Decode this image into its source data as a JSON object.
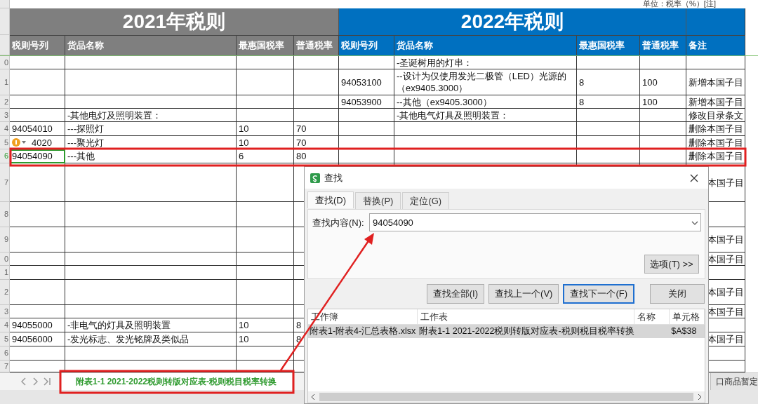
{
  "unit_note": "单位：税率（%）[注]",
  "sections": [
    {
      "title": "2021年税则",
      "kind": "grey"
    },
    {
      "title": "2022年税则",
      "kind": "blue"
    }
  ],
  "columns": [
    {
      "label": "税则号列",
      "kind": "grey"
    },
    {
      "label": "货品名称",
      "kind": "grey"
    },
    {
      "label": "最惠国税率",
      "kind": "grey"
    },
    {
      "label": "普通税率",
      "kind": "grey"
    },
    {
      "label": "税则号列",
      "kind": "blue"
    },
    {
      "label": "货品名称",
      "kind": "blue"
    },
    {
      "label": "最惠国税率",
      "kind": "blue"
    },
    {
      "label": "普通税率",
      "kind": "blue"
    },
    {
      "label": "备注",
      "kind": "blue"
    }
  ],
  "rows": [
    {
      "row_number": "0",
      "selected": false,
      "name_2022": "-圣诞树用的灯串："
    },
    {
      "row_number": "1",
      "selected": false,
      "code_2022": "94053100",
      "name_2022": "--设计为仅使用发光二极管（LED）光源的（ex9405.3000）",
      "mfn_2022": "8",
      "general_2022": "100",
      "note": "新增本国子目"
    },
    {
      "row_number": "2",
      "selected": false,
      "code_2022": "94053900",
      "name_2022": "--其他（ex9405.3000）",
      "mfn_2022": "8",
      "general_2022": "100",
      "note": "新增本国子目"
    },
    {
      "row_number": "3",
      "selected": false,
      "name_2021": "-其他电灯及照明装置：",
      "name_2022": "-其他电气灯具及照明装置：",
      "note": "修改目录条文"
    },
    {
      "row_number": "4",
      "selected": false,
      "code_2021": "94054010",
      "name_2021": "---探照灯",
      "mfn_2021": "10",
      "general_2021": "70",
      "note": "删除本国子目"
    },
    {
      "row_number": "5",
      "selected": false,
      "warning": true,
      "code_2021": "4020",
      "name_2021": "---聚光灯",
      "mfn_2021": "10",
      "general_2021": "70",
      "note": "删除本国子目"
    },
    {
      "row_number": "6",
      "selected": true,
      "code_2021": "94054090",
      "name_2021": "---其他",
      "mfn_2021": "6",
      "general_2021": "80",
      "note": "删除本国子目"
    },
    {
      "row_number": "7",
      "selected": false,
      "note": "本国子目"
    },
    {
      "row_number": "8",
      "selected": false
    },
    {
      "row_number": "9",
      "selected": false,
      "note": "本国子目"
    },
    {
      "row_number": "0",
      "selected": false,
      "note": "本国子目"
    },
    {
      "row_number": "1",
      "selected": false
    },
    {
      "row_number": "2",
      "selected": false,
      "note": "本国子目"
    },
    {
      "row_number": "3",
      "selected": false,
      "note": "本国子目"
    },
    {
      "row_number": "4",
      "selected": false,
      "code_2021": "94055000",
      "name_2021": "-非电气的灯具及照明装置",
      "mfn_2021": "10",
      "general_2021": "8"
    },
    {
      "row_number": "5",
      "selected": false,
      "code_2021": "94056000",
      "name_2021": "-发光标志、发光铭牌及类似品",
      "mfn_2021": "10",
      "general_2021": "8",
      "note": "本国子目"
    },
    {
      "row_number": "6",
      "selected": false
    },
    {
      "row_number": "7",
      "selected": false
    }
  ],
  "sheet_tabs": [
    {
      "label": "附表1-1 2021-2022税则转版对应表-税则税目税率转换",
      "selected": true
    },
    {
      "label": "口商品暂定",
      "selected": false
    }
  ],
  "dialog": {
    "title": "查找",
    "tabs": [
      {
        "label": "查找(D)",
        "selected": true
      },
      {
        "label": "替换(P)",
        "selected": false
      },
      {
        "label": "定位(G)",
        "selected": false
      }
    ],
    "field_label": "查找内容(N):",
    "field_value": "94054090",
    "options_button": "选项(T) >>",
    "buttons": [
      {
        "label": "查找全部(I)",
        "focused": false
      },
      {
        "label": "查找上一个(V)",
        "focused": false
      },
      {
        "label": "查找下一个(F)",
        "focused": true
      },
      {
        "label": "关闭",
        "focused": false
      }
    ],
    "results": {
      "columns": [
        "工作簿",
        "工作表",
        "名称",
        "单元格"
      ],
      "rows": [
        {
          "workbook": "附表1-附表4-汇总表格.xlsx",
          "sheet": "附表1-1 2021-2022税则转版对应表-税则税目税率转换",
          "cell": "$A$38",
          "selected": true
        }
      ]
    }
  }
}
